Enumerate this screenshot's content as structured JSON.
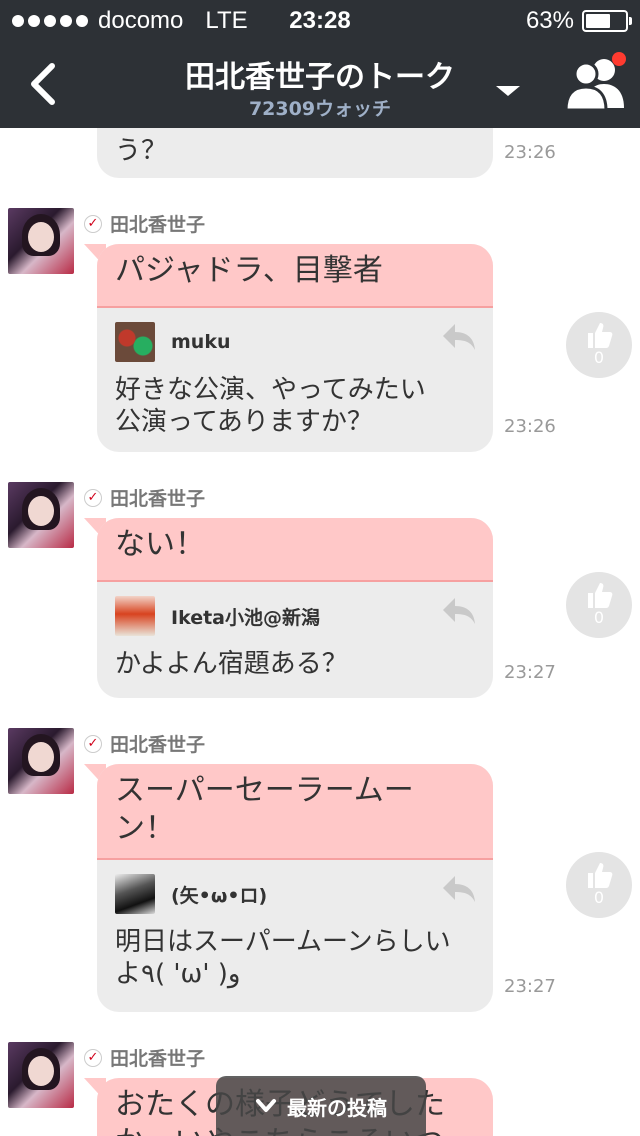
{
  "status": {
    "carrier": "docomo",
    "network": "LTE",
    "time": "23:28",
    "battery": "63%",
    "battery_level": 0.63
  },
  "header": {
    "title": "田北香世子のトーク",
    "subtitle": "72309ウォッチ",
    "notification": true
  },
  "top_fragment": {
    "text": "う？",
    "time": "23:26"
  },
  "messages": [
    {
      "sender": "田北香世子",
      "text": "パジャドラ、目撃者",
      "reply_user": "muku",
      "reply_text": "好きな公演、やってみたい\n公演ってありますか？",
      "time": "23:26",
      "likes": "0"
    },
    {
      "sender": "田北香世子",
      "text": "ない！",
      "reply_user": "Iketa小池@新潟",
      "reply_text": "かよよん宿題ある？",
      "time": "23:27",
      "likes": "0"
    },
    {
      "sender": "田北香世子",
      "text": "スーパーセーラームー\nン！",
      "reply_user": "(矢•ω•ロ)",
      "reply_text": "明日はスーパームーンらしい\nよ٩( 'ω' )و",
      "time": "23:27",
      "likes": "0"
    },
    {
      "sender": "田北香世子",
      "text": "おたくの様子どうでした\nか、いやこちらこそいつ"
    }
  ],
  "floating": {
    "label": "最新の投稿"
  },
  "colors": {
    "header_bg": "#2d3136",
    "bubble_pink": "#ffc8c8",
    "bubble_gray": "#ececec",
    "accent_red": "#d0021b"
  }
}
